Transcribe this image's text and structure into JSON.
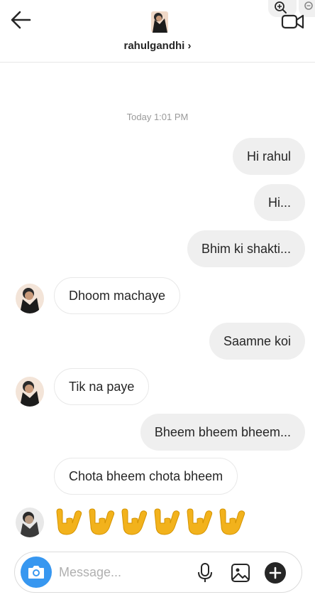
{
  "header": {
    "username": "rahulgandhi",
    "chevron": "›",
    "icons": {
      "back": "arrow-left-icon",
      "video": "video-camera-icon",
      "zoom": "magnifier-plus-icon"
    }
  },
  "thread": {
    "timestamp": "Today 1:01 PM",
    "messages": [
      {
        "from": "me",
        "text": "Hi rahul"
      },
      {
        "from": "me",
        "text": "Hi..."
      },
      {
        "from": "me",
        "text": "Bhim ki shakti..."
      },
      {
        "from": "them",
        "text": "Dhoom machaye"
      },
      {
        "from": "me",
        "text": "Saamne koi"
      },
      {
        "from": "them",
        "text": "Tik na paye"
      },
      {
        "from": "me",
        "text": "Bheem bheem bheem..."
      },
      {
        "from": "them",
        "text": "Chota bheem chota bheem"
      }
    ],
    "emoji_message": {
      "from": "them",
      "emoji": "love-you-gesture-hand",
      "count": 6
    }
  },
  "composer": {
    "placeholder": "Message...",
    "icons": {
      "camera": "camera-icon",
      "mic": "microphone-icon",
      "gallery": "gallery-icon",
      "more": "plus-circle-icon"
    },
    "accent": "#3797f0"
  }
}
